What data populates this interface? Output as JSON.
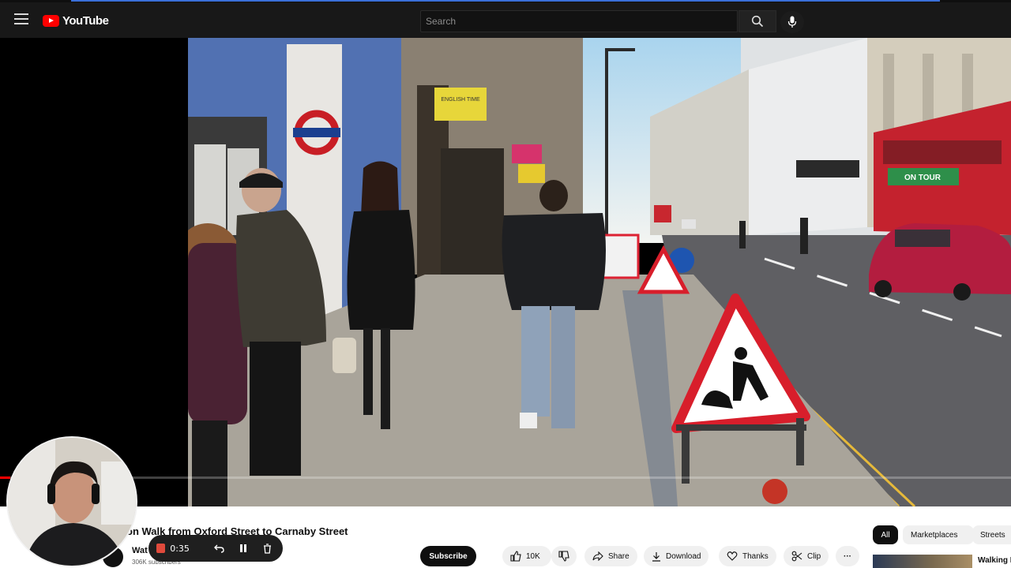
{
  "header": {
    "logo_text": "YouTube",
    "search_placeholder": "Search"
  },
  "video": {
    "title": "on Walk from Oxford Street to Carnaby Street",
    "progress_fraction": 0.01,
    "signs": {
      "shop_sign_top": "ENGLISH TIME",
      "bus_text": "ON TOUR"
    }
  },
  "channel": {
    "name": "Wat",
    "subscribers": "306K subscribers",
    "subscribe_label": "Subscribe"
  },
  "actions": {
    "like_count": "10K",
    "share_label": "Share",
    "download_label": "Download",
    "thanks_label": "Thanks",
    "clip_label": "Clip",
    "more_label": "···"
  },
  "chips": {
    "all": "All",
    "marketplaces": "Marketplaces",
    "streets": "Streets"
  },
  "next_video": {
    "title": "Walking L"
  },
  "recorder": {
    "elapsed": "0:35"
  },
  "colors": {
    "brand_red": "#ff0000",
    "record_red": "#e04a3c",
    "sign_red": "#d81e2b",
    "bus_red": "#c4222e"
  }
}
